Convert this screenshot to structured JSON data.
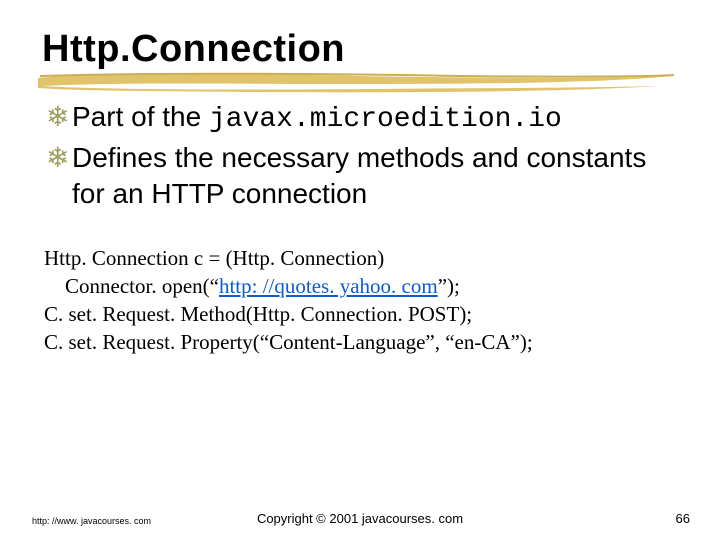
{
  "title": "Http.Connection",
  "bullets": [
    {
      "prefix": "Part of the ",
      "code": "javax.microedition.io",
      "suffix": ""
    },
    {
      "prefix": "Defines the necessary methods and constants for an HTTP connection",
      "code": "",
      "suffix": ""
    }
  ],
  "code": {
    "line1_a": "Http. Connection c = (Http. Connection)",
    "line2_a": "    Connector. open(“",
    "line2_link": "http: //quotes. yahoo. com",
    "line2_b": "”);",
    "line3": "C. set. Request. Method(Http. Connection. POST);",
    "line4": "C. set. Request. Property(“Content-Language”, “en-CA”);"
  },
  "footer": {
    "left": "http: //www. javacourses. com",
    "center": "Copyright © 2001 javacourses. com",
    "right": "66"
  }
}
